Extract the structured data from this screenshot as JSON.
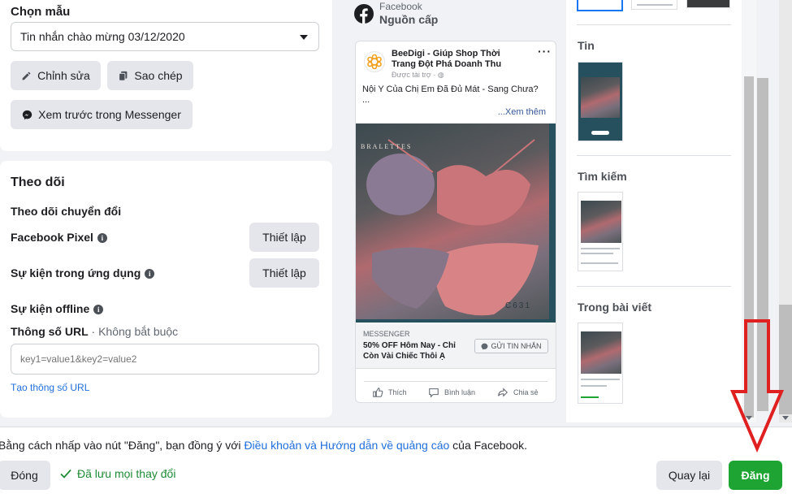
{
  "template_section": {
    "title": "Chọn mẫu",
    "selected_template": "Tin nhắn chào mừng 03/12/2020",
    "edit_label": "Chỉnh sửa",
    "copy_label": "Sao chép",
    "preview_messenger_label": "Xem trước trong Messenger"
  },
  "tracking": {
    "title": "Theo dõi",
    "conversion_label": "Theo dõi chuyển đổi",
    "pixel_label": "Facebook Pixel",
    "pixel_button": "Thiết lập",
    "app_events_label": "Sự kiện trong ứng dụng",
    "app_events_button": "Thiết lập",
    "offline_label": "Sự kiện offline",
    "url_params_label": "Thông số URL",
    "url_params_optional": " · Không bắt buộc",
    "url_params_placeholder": "key1=value1&key2=value2",
    "build_url_link": "Tạo thông số URL"
  },
  "preview": {
    "platform": "Facebook",
    "placement": "Nguồn cấp",
    "advertiser": "BeeDigi - Giúp Shop Thời Trang Đột Phá Doanh Thu",
    "sponsored": "Được tài trợ ·",
    "body": "Nội Y Của Chị Em Đã Đủ Mát - Sang Chưa?",
    "body_more": "...",
    "see_more": "...Xem thêm",
    "image_brand": "BRALETTES",
    "image_code": "C631",
    "cta_source": "MESSENGER",
    "cta_headline": "50% OFF Hôm Nay - Chỉ Còn Vài Chiếc Thôi Ạ",
    "cta_button": "GỬI TIN NHẮN",
    "like": "Thích",
    "comment": "Bình luận",
    "share": "Chia sẻ"
  },
  "placements": {
    "sections": [
      "Tin",
      "Tìm kiếm",
      "Trong bài viết"
    ]
  },
  "footer": {
    "terms_prefix": "Bằng cách nhấp vào nút \"Đăng\", bạn đồng ý với ",
    "terms_link": "Điều khoản và Hướng dẫn về quảng cáo",
    "terms_suffix": " của Facebook.",
    "close": "Đóng",
    "saved": "Đã lưu mọi thay đổi",
    "back": "Quay lại",
    "publish": "Đăng"
  },
  "colors": {
    "link": "#216fdb",
    "publish": "#1da432",
    "saved": "#1f8a35",
    "annotation_arrow": "#e02020"
  }
}
